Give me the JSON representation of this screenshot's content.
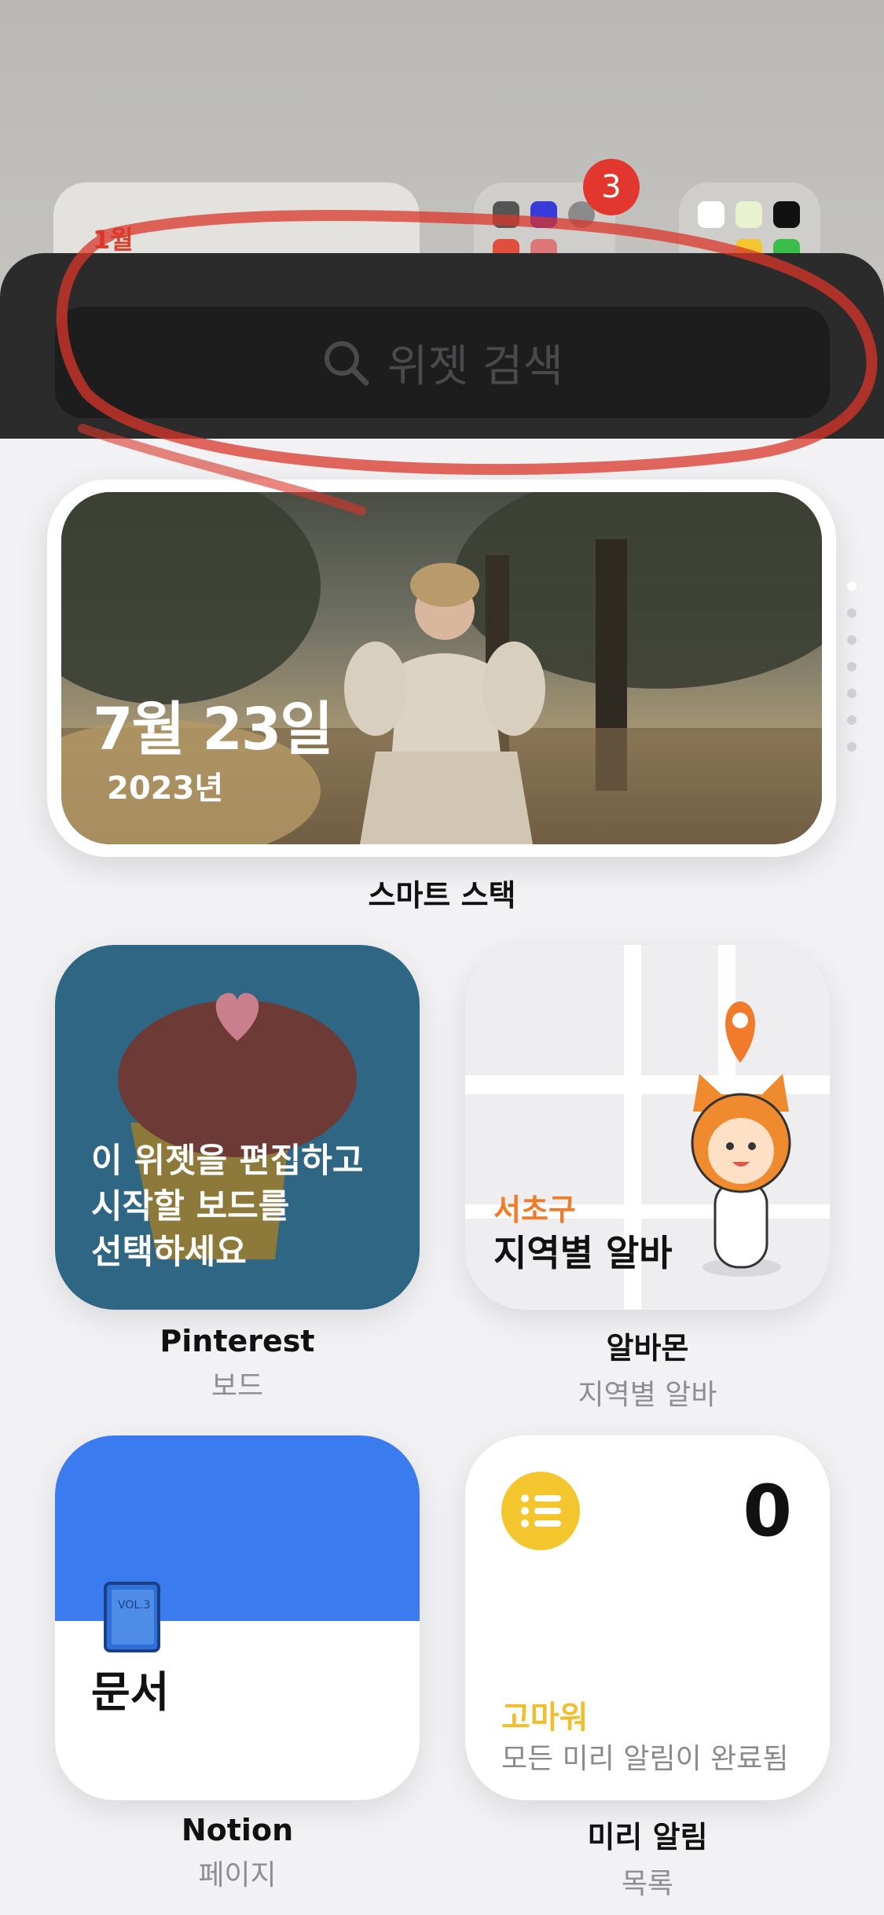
{
  "home": {
    "calendar_month": "1월",
    "folder_badge": "3"
  },
  "search": {
    "placeholder": "위젯 검색"
  },
  "smart_stack": {
    "date": "7월 23일",
    "year": "2023년",
    "label": "스마트 스택",
    "pages": 7,
    "active_page": 1
  },
  "widgets": [
    {
      "name": "Pinterest",
      "subtitle": "보드",
      "body": "이 위젯을 편집하고\n시작할 보드를\n선택하세요"
    },
    {
      "name": "알바몬",
      "subtitle": "지역별 알바",
      "region": "서초구",
      "body": "지역별 알바"
    },
    {
      "name": "Notion",
      "subtitle": "페이지",
      "body": "문서"
    },
    {
      "name": "미리 알림",
      "subtitle": "목록",
      "count": "0",
      "thanks": "고마워",
      "body": "모든 미리 알림이 완료됨"
    }
  ],
  "colors": {
    "pinterest_bg": "#2e6684",
    "notion_blue": "#3a7bef",
    "reminder_yellow": "#f4c62e",
    "alba_orange": "#f07b2a",
    "annotation_red": "#d9352a"
  }
}
